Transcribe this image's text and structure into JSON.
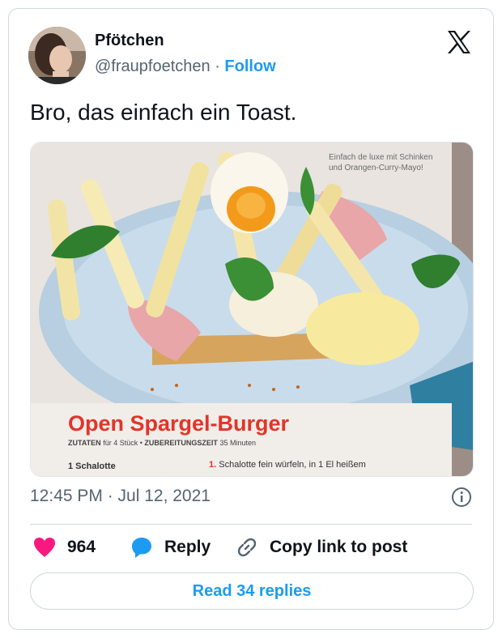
{
  "author": {
    "name": "Pfötchen",
    "handle": "@fraupfoetchen",
    "separator": "·",
    "follow_label": "Follow"
  },
  "tweet": {
    "text": "Bro, das einfach ein Toast.",
    "timestamp": "12:45 PM · Jul 12, 2021"
  },
  "photo": {
    "corner_note": "Einfach de luxe mit Schinken und Orangen-Curry-Mayo!",
    "recipe_title": "Open Spargel-Burger",
    "meta_zutaten": "ZUTATEN",
    "meta_fuer": "für 4 Stück",
    "meta_dot": "•",
    "meta_zeit": "ZUBEREITUNGSZEIT",
    "meta_minuten": "35 Minuten",
    "ingredient": "1 Schalotte",
    "step_number": "1.",
    "step_text": "Schalotte fein würfeln, in 1 El heißem"
  },
  "actions": {
    "likes": "964",
    "reply_label": "Reply",
    "copy_label": "Copy link to post"
  },
  "read_replies_label": "Read 34 replies",
  "colors": {
    "accent": "#1d9bf0",
    "like": "#f91880",
    "muted": "#536471",
    "recipe_red": "#e0352b"
  },
  "icons": [
    "x-logo-icon",
    "info-icon",
    "heart-icon",
    "reply-bubble-icon",
    "link-icon"
  ]
}
